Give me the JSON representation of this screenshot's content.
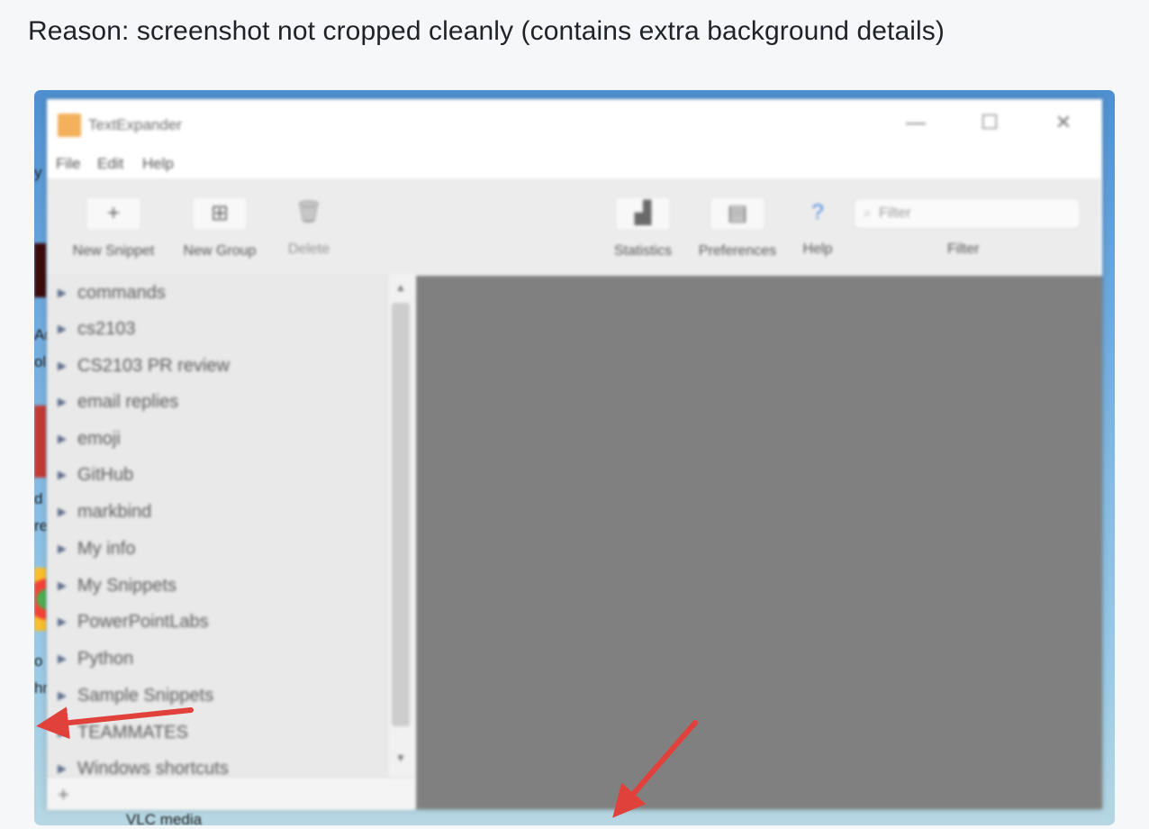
{
  "caption": "Reason: screenshot not cropped cleanly (contains extra background details)",
  "desktop": {
    "fragments": [
      "y",
      "Ad",
      "ol",
      "d",
      "re",
      "o",
      "hr"
    ],
    "vlc_label": "VLC media"
  },
  "window": {
    "title": "TextExpander",
    "controls": {
      "minimize": "—",
      "maximize": "☐",
      "close": "✕"
    },
    "menu": [
      "File",
      "Edit",
      "Help"
    ],
    "toolbar": {
      "new_snippet": "New Snippet",
      "new_group": "New Group",
      "delete": "Delete",
      "statistics": "Statistics",
      "preferences": "Preferences",
      "help": "Help",
      "filter_placeholder": "Filter",
      "filter_label": "Filter"
    },
    "groups": [
      "commands",
      "cs2103",
      "CS2103 PR review",
      "email replies",
      "emoji",
      "GitHub",
      "markbind",
      "My info",
      "My Snippets",
      "PowerPointLabs",
      "Python",
      "Sample Snippets",
      "TEAMMATES",
      "Windows shortcuts"
    ]
  },
  "colors": {
    "arrow": "#e0413a",
    "detail_pane": "#808080",
    "app_icon": "#f2b15a"
  }
}
